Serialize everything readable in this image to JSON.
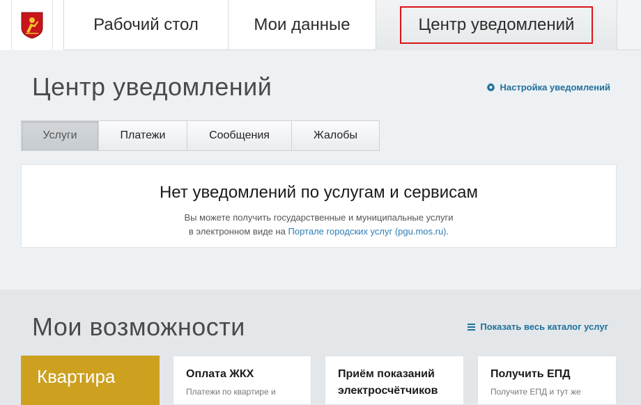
{
  "nav": {
    "logo": "moscow-coat-of-arms-icon",
    "tabs": [
      "Рабочий стол",
      "Мои данные",
      "Центр уведомлений"
    ]
  },
  "notifications": {
    "title": "Центр уведомлений",
    "settings_link": "Настройка уведомлений",
    "tabs": [
      "Услуги",
      "Платежи",
      "Сообщения",
      "Жалобы"
    ],
    "active_tab": "Услуги",
    "empty_title": "Нет уведомлений по услугам и сервисам",
    "empty_line1": "Вы можете получить государственные и муниципальные услуги",
    "empty_line2_prefix": "в электронном виде на ",
    "empty_link": "Порталe городских услуг (pgu.mos.ru)",
    "empty_line2_suffix": "."
  },
  "capabilities": {
    "title": "Мои возможности",
    "catalog_link": "Показать весь каталог услуг",
    "cards": [
      {
        "name": "Квартира"
      },
      {
        "name": "Оплата ЖКХ",
        "desc": "Платежи по квартире и"
      },
      {
        "name": "Приём показаний электросчётчиков",
        "desc": ""
      },
      {
        "name": "Получить ЕПД",
        "desc": "Получите ЕПД и тут же"
      }
    ]
  },
  "colors": {
    "accent": "#1f6f9a",
    "highlight_border": "#d9151a",
    "gold_card": "#cda01f"
  }
}
